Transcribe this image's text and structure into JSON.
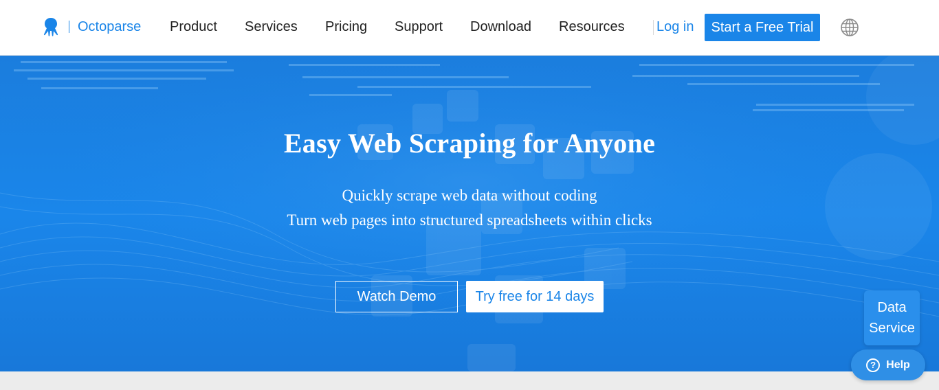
{
  "brand": {
    "name": "Octoparse",
    "logo_icon": "octopus-logo-icon",
    "color": "#1a85e8"
  },
  "nav": {
    "items": [
      {
        "label": "Product"
      },
      {
        "label": "Services"
      },
      {
        "label": "Pricing"
      },
      {
        "label": "Support"
      },
      {
        "label": "Download"
      },
      {
        "label": "Resources"
      }
    ],
    "login_label": "Log in",
    "trial_label": "Start a Free Trial",
    "language_icon": "globe-icon"
  },
  "hero": {
    "title": "Easy Web Scraping for Anyone",
    "subtitle_line1": "Quickly scrape web data without coding",
    "subtitle_line2": "Turn web pages into structured spreadsheets within clicks",
    "watch_demo_label": "Watch Demo",
    "try_free_label": "Try free for 14 days",
    "background_color": "#1a86ea"
  },
  "widgets": {
    "data_service_label": "Data Service",
    "help_label": "Help",
    "help_icon": "question-circle-icon"
  }
}
